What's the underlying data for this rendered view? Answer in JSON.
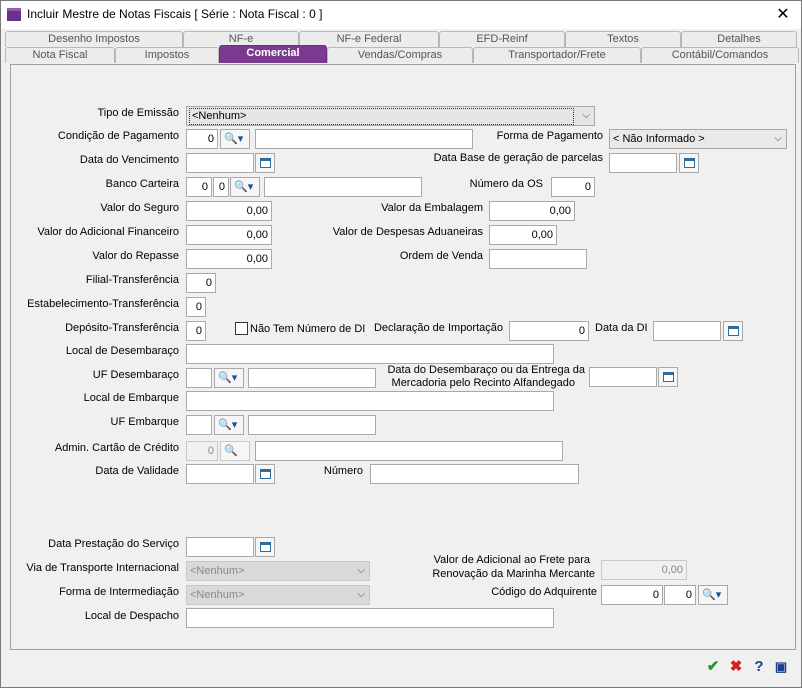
{
  "window": {
    "title": "Incluir Mestre de Notas Fiscais [ Série :     Nota Fiscal : 0 ]"
  },
  "tabs_top": [
    "Desenho Impostos",
    "NF-e",
    "NF-e Federal",
    "EFD-Reinf",
    "Textos",
    "Detalhes"
  ],
  "tabs_bottom": [
    "Nota Fiscal",
    "Impostos",
    "Comercial",
    "Vendas/Compras",
    "Transportador/Frete",
    "Contábil/Comandos"
  ],
  "active_tab": "Comercial",
  "form": {
    "tipo_emissao": {
      "label": "Tipo de Emissão",
      "value": "<Nenhum>"
    },
    "condicao_pagamento": {
      "label": "Condição de Pagamento",
      "code": "0",
      "desc": ""
    },
    "forma_pagamento": {
      "label": "Forma de Pagamento",
      "value": "< Não Informado >"
    },
    "data_vencimento": {
      "label": "Data do Vencimento",
      "value": ""
    },
    "data_base": {
      "label": "Data Base de geração de parcelas",
      "value": ""
    },
    "banco_carteira": {
      "label": "Banco Carteira",
      "a": "0",
      "b": "0",
      "desc": ""
    },
    "numero_os": {
      "label": "Número da OS",
      "value": "0"
    },
    "valor_seguro": {
      "label": "Valor do Seguro",
      "value": "0,00"
    },
    "valor_embalagem": {
      "label": "Valor da Embalagem",
      "value": "0,00"
    },
    "valor_adic_fin": {
      "label": "Valor do Adicional Financeiro",
      "value": "0,00"
    },
    "valor_desp_adu": {
      "label": "Valor de Despesas Aduaneiras",
      "value": "0,00"
    },
    "valor_repasse": {
      "label": "Valor do Repasse",
      "value": "0,00"
    },
    "ordem_venda": {
      "label": "Ordem de Venda",
      "value": ""
    },
    "filial_transf": {
      "label": "Filial-Transferência",
      "value": "0"
    },
    "estab_transf": {
      "label": "Estabelecimento-Transferência",
      "value": "0"
    },
    "deposito_transf": {
      "label": "Depósito-Transferência",
      "value": "0"
    },
    "nao_tem_di": {
      "label": "Não Tem Número de DI"
    },
    "declaracao_importacao": {
      "label": "Declaração de Importação",
      "value": "0"
    },
    "data_di": {
      "label": "Data da DI",
      "value": ""
    },
    "local_desembaraco": {
      "label": "Local de Desembaraço",
      "value": ""
    },
    "uf_desembaraco": {
      "label": "UF Desembaraço",
      "value": "",
      "desc": ""
    },
    "data_desembaraco": {
      "label_1": "Data do Desembaraço ou da Entrega da",
      "label_2": "Mercadoria pelo Recinto Alfandegado",
      "value": ""
    },
    "local_embarque": {
      "label": "Local de Embarque",
      "value": ""
    },
    "uf_embarque": {
      "label": "UF Embarque",
      "value": "",
      "desc": ""
    },
    "admin_cartao": {
      "label": "Admin. Cartão de Crédito",
      "value": "0",
      "desc": ""
    },
    "data_validade": {
      "label": "Data de Validade",
      "value": ""
    },
    "numero": {
      "label": "Número",
      "value": ""
    },
    "data_prestacao": {
      "label": "Data Prestação do Serviço",
      "value": ""
    },
    "via_transporte": {
      "label": "Via de Transporte Internacional",
      "value": "<Nenhum>"
    },
    "valor_afrmm": {
      "label_1": "Valor de Adicional ao Frete para",
      "label_2": "Renovação da Marinha Mercante",
      "value": "0,00"
    },
    "forma_intermediacao": {
      "label": "Forma de Intermediação",
      "value": "<Nenhum>"
    },
    "codigo_adquirente": {
      "label": "Código do Adquirente",
      "a": "0",
      "b": "0"
    },
    "local_despacho": {
      "label": "Local de Despacho",
      "value": ""
    }
  },
  "footer": {
    "ok": "✔",
    "cancel": "✖",
    "help": "?",
    "extra": "▣"
  }
}
